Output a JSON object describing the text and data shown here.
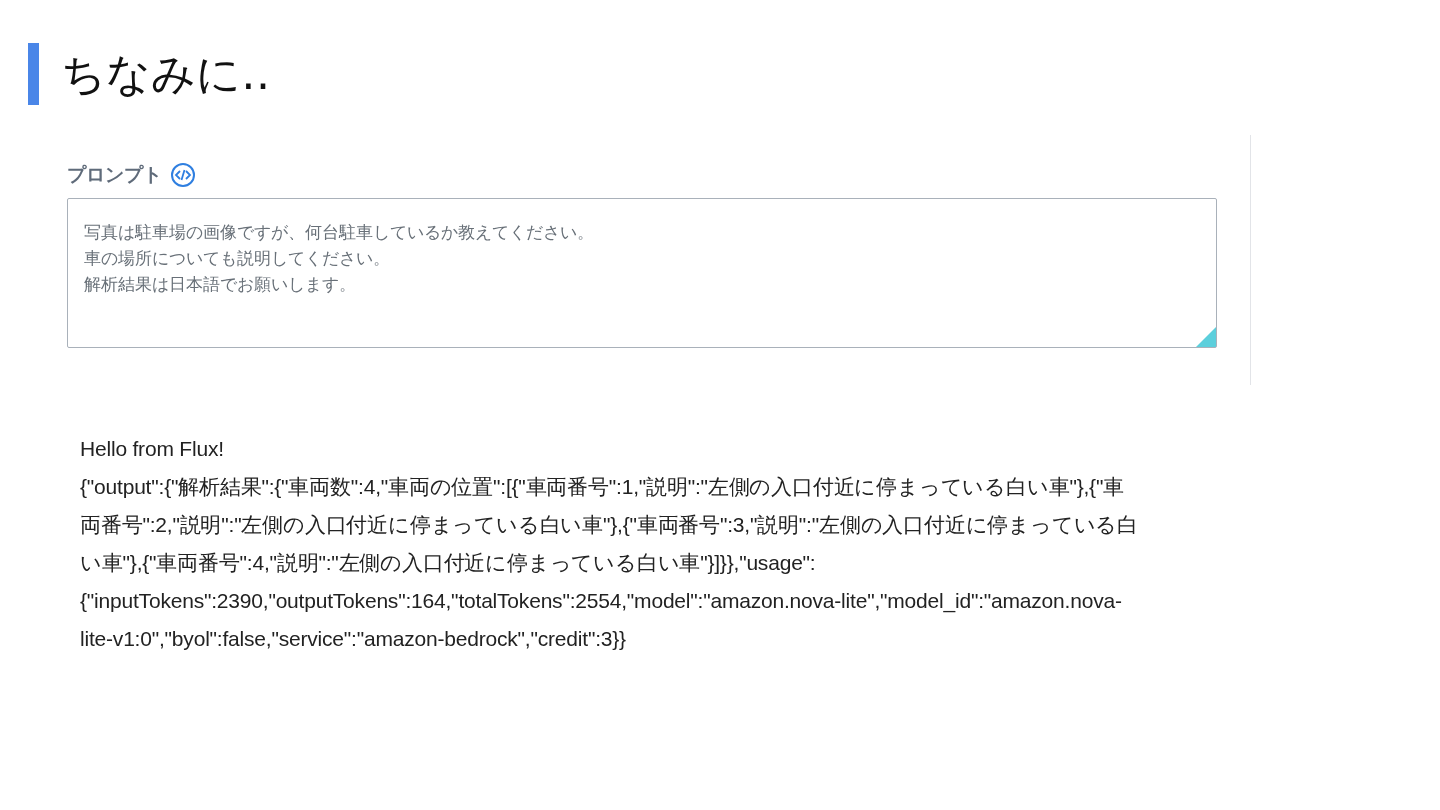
{
  "slide_title": "ちなみに‥",
  "prompt": {
    "label": "プロンプト",
    "value_lines": [
      "写真は駐車場の画像ですが、何台駐車しているか教えてください。",
      "車の場所についても説明してください。",
      "解析結果は日本語でお願いします。"
    ]
  },
  "output": {
    "lines": [
      "Hello from Flux!",
      "{\"output\":{\"解析結果\":{\"車両数\":4,\"車両の位置\":[{\"車両番号\":1,\"説明\":\"左側の入口付近に停まっている白い車\"},{\"車",
      "両番号\":2,\"説明\":\"左側の入口付近に停まっている白い車\"},{\"車両番号\":3,\"説明\":\"左側の入口付近に停まっている白",
      "い車\"},{\"車両番号\":4,\"説明\":\"左側の入口付近に停まっている白い車\"}]}},\"usage\":",
      "{\"inputTokens\":2390,\"outputTokens\":164,\"totalTokens\":2554,\"model\":\"amazon.nova-lite\",\"model_id\":\"amazon.nova-",
      "lite-v1:0\",\"byol\":false,\"service\":\"amazon-bedrock\",\"credit\":3}}"
    ]
  }
}
